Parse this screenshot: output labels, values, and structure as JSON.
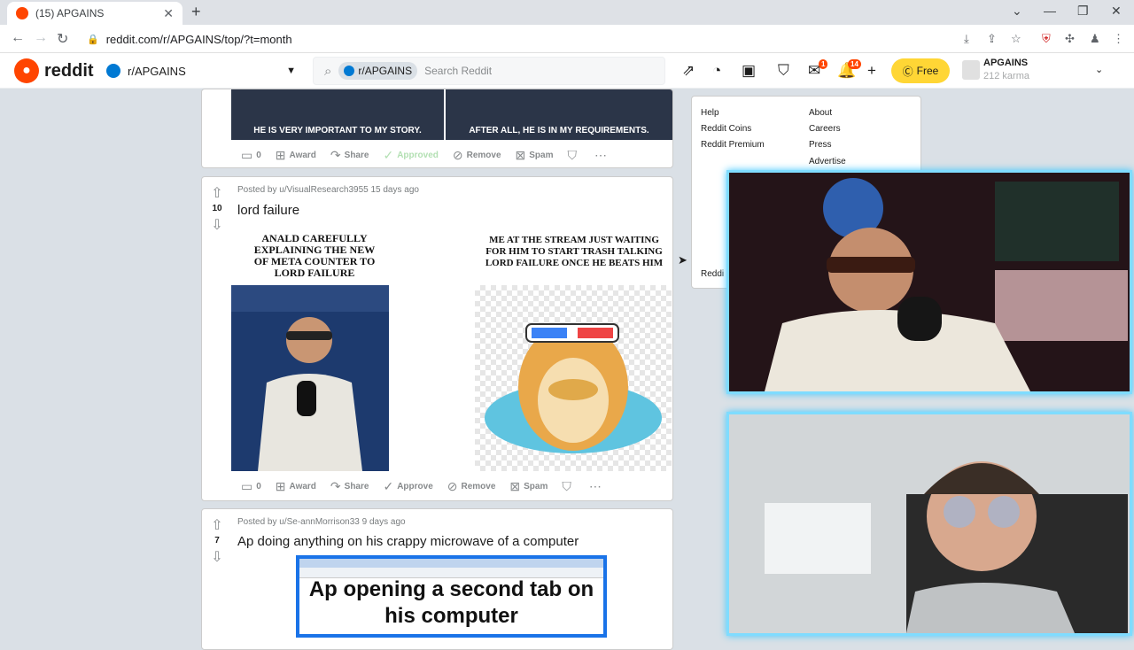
{
  "browser": {
    "tab_title": "(15) APGAINS",
    "tab_close": "✕",
    "new_tab": "+",
    "url": "reddit.com/r/APGAINS/top/?t=month",
    "win_min": "—",
    "win_max": "❐",
    "win_close": "✕"
  },
  "header": {
    "logo_text": "reddit",
    "community": "r/APGAINS",
    "search_chip": "r/APGAINS",
    "search_placeholder": "Search Reddit",
    "chat_badge": "1",
    "notif_badge": "14",
    "free_label": "Free",
    "username": "APGAINS",
    "karma": "212 karma"
  },
  "posts": [
    {
      "captions": [
        "HE IS VERY IMPORTANT TO MY STORY.",
        "AFTER ALL, HE IS IN MY REQUIREMENTS."
      ],
      "actions": {
        "comments": "0",
        "award": "Award",
        "share": "Share",
        "approve": "Approved",
        "remove": "Remove",
        "spam": "Spam"
      }
    },
    {
      "score": "10",
      "meta": "Posted by u/VisualResearch3955 15 days ago",
      "title": "lord failure",
      "caption_left": "ANALD CAREFULLY EXPLAINING THE NEW OF META COUNTER TO LORD FAILURE",
      "caption_right": "ME AT THE STREAM JUST WAITING FOR HIM TO START TRASH TALKING LORD FAILURE ONCE HE BEATS HIM",
      "actions": {
        "comments": "0",
        "award": "Award",
        "share": "Share",
        "approve": "Approve",
        "remove": "Remove",
        "spam": "Spam"
      }
    },
    {
      "score": "7",
      "meta": "Posted by u/Se-annMorrison33 9 days ago",
      "title": "Ap doing anything on his crappy microwave of a computer",
      "image_caption": "Ap opening a second tab on his computer"
    }
  ],
  "sidebar": {
    "left_links": [
      "Help",
      "Reddit Coins",
      "Reddit Premium"
    ],
    "right_links": [
      "About",
      "Careers",
      "Press",
      "Advertise"
    ],
    "footer_partial": "Reddi"
  },
  "colors": {
    "reddit_orange": "#ff4500",
    "webcam_border": "#7fdcff",
    "premium_yellow": "#ffd635"
  }
}
